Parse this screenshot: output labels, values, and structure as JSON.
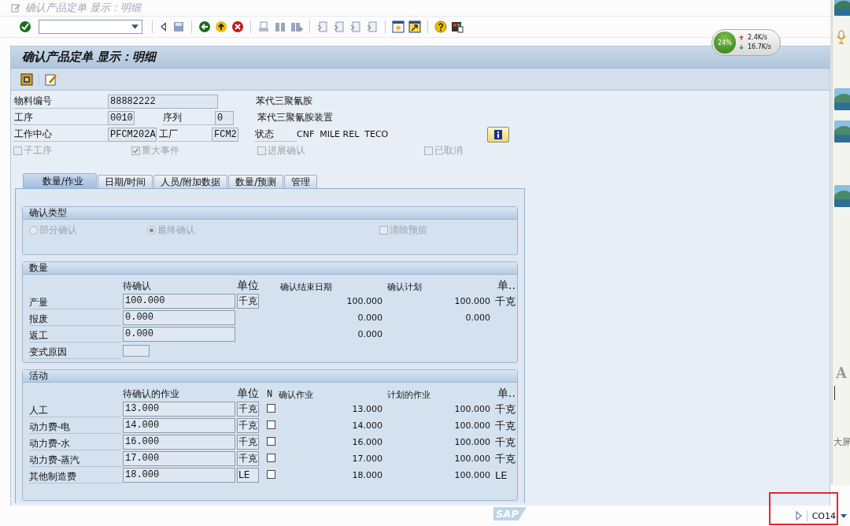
{
  "window": {
    "title": "确认产品定单 显示：明细"
  },
  "network_widget": {
    "percent": "24%",
    "upload": "2.4K/s",
    "download": "16.7K/s"
  },
  "screen": {
    "title": "确认产品定单 显示：明细"
  },
  "header": {
    "material": {
      "label": "物料编号",
      "value": "88882222",
      "description": "苯代三聚氰胺"
    },
    "operation": {
      "label": "工序",
      "value": "0010",
      "label2": "序列",
      "value2": "0",
      "description": "苯代三聚氰胺装置"
    },
    "work_center": {
      "label": "工作中心",
      "value": "PFCM202A",
      "label2": "工厂",
      "value2": "FCM2",
      "status_label": "状态",
      "status": "CNF  MILE REL  TECO"
    }
  },
  "flags": [
    {
      "label": "子工序",
      "checked": false,
      "disabled": true
    },
    {
      "label": "重大事件",
      "checked": true,
      "disabled": true
    },
    {
      "label": "进展确认",
      "checked": false,
      "disabled": true
    },
    {
      "label": "已取消",
      "checked": false,
      "disabled": true
    }
  ],
  "tabs": [
    {
      "label": "数量/作业",
      "selected": true
    },
    {
      "label": "日期/时间",
      "selected": false
    },
    {
      "label": "人员/附加数据",
      "selected": false
    },
    {
      "label": "数量/预测",
      "selected": false
    },
    {
      "label": "管理",
      "selected": false
    }
  ],
  "confirmation_type": {
    "title": "确认类型",
    "options": [
      {
        "kind": "radio",
        "label": "部分确认",
        "selected": false,
        "disabled": true
      },
      {
        "kind": "radio",
        "label": "最终确认",
        "selected": true,
        "disabled": true
      },
      {
        "kind": "checkbox",
        "label": "清除预留",
        "checked": false,
        "disabled": true
      }
    ]
  },
  "quantities": {
    "title": "数量",
    "columns": [
      "待确认",
      "单位",
      "确认结束日期",
      "确认计划",
      "单.."
    ],
    "rows": [
      {
        "kind": "quantity",
        "label": "产量",
        "value": "100.000",
        "unit": "千克",
        "confirmed": "100.000",
        "planned": "100.000",
        "planned_unit": "千克"
      },
      {
        "kind": "quantity",
        "label": "报废",
        "value": "0.000",
        "confirmed": "0.000",
        "planned": "0.000"
      },
      {
        "kind": "quantity",
        "label": "返工",
        "value": "0.000",
        "confirmed": "0.000"
      },
      {
        "kind": "code",
        "label": "变式原因"
      }
    ]
  },
  "activities": {
    "title": "活动",
    "columns": [
      "待确认的作业",
      "单位",
      "N",
      "确认作业",
      "计划的作业",
      "单.."
    ],
    "rows": [
      {
        "label": "人工",
        "value": "13.000",
        "unit": "千克",
        "no_remaining": false,
        "confirmed": "13.000",
        "planned": "100.000",
        "planned_unit": "千克"
      },
      {
        "label": "动力费-电",
        "value": "14.000",
        "unit": "千克",
        "no_remaining": false,
        "confirmed": "14.000",
        "planned": "100.000",
        "planned_unit": "千克"
      },
      {
        "label": "动力费-水",
        "value": "16.000",
        "unit": "千克",
        "no_remaining": false,
        "confirmed": "16.000",
        "planned": "100.000",
        "planned_unit": "千克"
      },
      {
        "label": "动力费-蒸汽",
        "value": "17.000",
        "unit": "千克",
        "no_remaining": false,
        "confirmed": "17.000",
        "planned": "100.000",
        "planned_unit": "千克"
      },
      {
        "label": "其他制造费",
        "value": "18.000",
        "unit": "LE",
        "no_remaining": false,
        "confirmed": "18.000",
        "planned": "100.000",
        "planned_unit": "LE"
      }
    ]
  },
  "status_bar": {
    "logo": "SAP",
    "transaction": "CO14"
  },
  "side_panel": {
    "font_glyph": "A",
    "label": "大屏"
  }
}
